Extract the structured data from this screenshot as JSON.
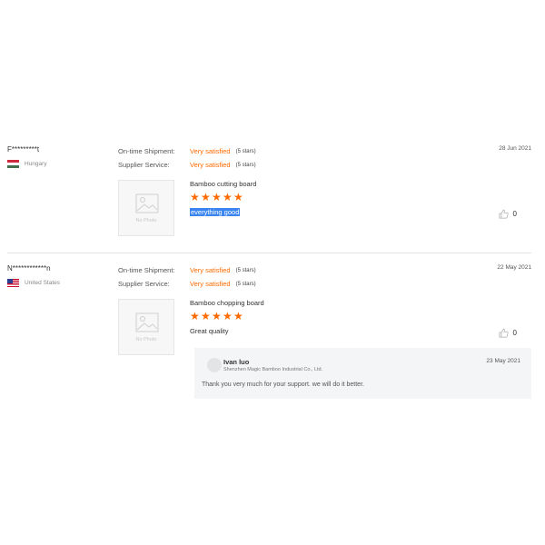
{
  "reviews": [
    {
      "username": "F*********t",
      "country": "Hungary",
      "ratings": [
        {
          "label": "On-time Shipment:",
          "value": "Very satisfied",
          "stars": "(5 stars)"
        },
        {
          "label": "Supplier Service:",
          "value": "Very satisfied",
          "stars": "(5 stars)"
        }
      ],
      "date": "28 Jun 2021",
      "photo_label": "No Photo",
      "product": "Bamboo cutting board",
      "rating_stars": 5,
      "comment": "everything good",
      "likes": "0"
    },
    {
      "username": "N************n",
      "country": "United States",
      "ratings": [
        {
          "label": "On-time Shipment:",
          "value": "Very satisfied",
          "stars": "(5 stars)"
        },
        {
          "label": "Supplier Service:",
          "value": "Very satisfied",
          "stars": "(5 stars)"
        }
      ],
      "date": "22 May 2021",
      "photo_label": "No Photo",
      "product": "Bamboo chopping board",
      "rating_stars": 5,
      "comment": "Great quality",
      "likes": "0",
      "reply": {
        "name": "Ivan luo",
        "company": "Shenzhen Magic Bamboo Industrial Co., Ltd.",
        "date": "23 May 2021",
        "text": "Thank you very much for your support.  we will do it better."
      }
    }
  ],
  "colors": {
    "accent": "#ff6a00",
    "highlight": "#3a84f0"
  },
  "icons": {
    "photo_placeholder": "image-icon",
    "like": "thumbs-up-icon",
    "star": "star-icon"
  }
}
